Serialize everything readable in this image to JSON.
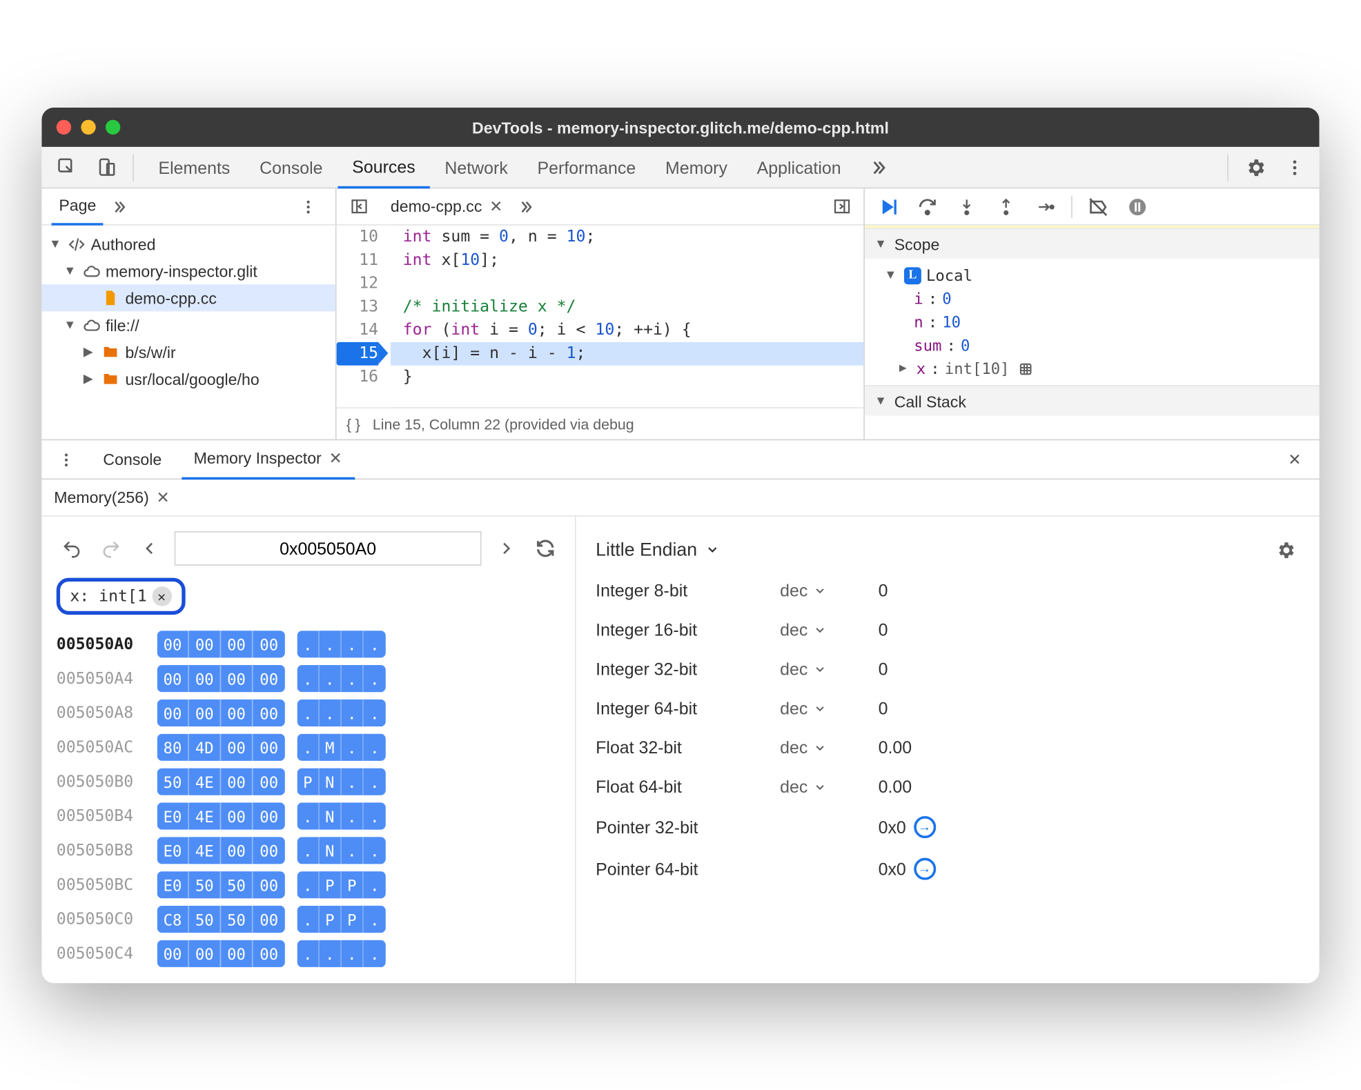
{
  "titlebar": {
    "title": "DevTools - memory-inspector.glitch.me/demo-cpp.html"
  },
  "tabs": {
    "items": [
      "Elements",
      "Console",
      "Sources",
      "Network",
      "Performance",
      "Memory",
      "Application"
    ],
    "active": "Sources"
  },
  "page_tree": {
    "header": "Page",
    "authored": "Authored",
    "site": "memory-inspector.glit",
    "file": "demo-cpp.cc",
    "file_scheme": "file://",
    "folder1": "b/s/w/ir",
    "folder2": "usr/local/google/ho"
  },
  "editor": {
    "tab": "demo-cpp.cc",
    "lines": {
      "10": "int sum = 0, n = 10;",
      "11": "int x[10];",
      "12": "",
      "13": "/* initialize x */",
      "14": "for (int i = 0; i < 10; ++i) {",
      "15": "  x[i] = n - i - 1;",
      "16": "}"
    },
    "status": "Line 15, Column 22 (provided via debug"
  },
  "scope": {
    "hdr": "Scope",
    "local": "Local",
    "vars": {
      "i_key": "i",
      "i_val": "0",
      "n_key": "n",
      "n_val": "10",
      "sum_key": "sum",
      "sum_val": "0",
      "x_key": "x",
      "x_type": "int[10]"
    },
    "callstack": "Call Stack"
  },
  "drawer": {
    "tabs": {
      "console": "Console",
      "mi": "Memory Inspector"
    },
    "mem_tab": "Memory(256)"
  },
  "mi": {
    "address": "0x005050A0",
    "chip": "x: int[1",
    "rows": [
      {
        "addr": "005050A0",
        "bytes": [
          "00",
          "00",
          "00",
          "00"
        ],
        "ascii": [
          ".",
          ".",
          ".",
          "."
        ]
      },
      {
        "addr": "005050A4",
        "bytes": [
          "00",
          "00",
          "00",
          "00"
        ],
        "ascii": [
          ".",
          ".",
          ".",
          "."
        ]
      },
      {
        "addr": "005050A8",
        "bytes": [
          "00",
          "00",
          "00",
          "00"
        ],
        "ascii": [
          ".",
          ".",
          ".",
          "."
        ]
      },
      {
        "addr": "005050AC",
        "bytes": [
          "80",
          "4D",
          "00",
          "00"
        ],
        "ascii": [
          ".",
          "M",
          ".",
          "."
        ]
      },
      {
        "addr": "005050B0",
        "bytes": [
          "50",
          "4E",
          "00",
          "00"
        ],
        "ascii": [
          "P",
          "N",
          ".",
          "."
        ]
      },
      {
        "addr": "005050B4",
        "bytes": [
          "E0",
          "4E",
          "00",
          "00"
        ],
        "ascii": [
          ".",
          "N",
          ".",
          "."
        ]
      },
      {
        "addr": "005050B8",
        "bytes": [
          "E0",
          "4E",
          "00",
          "00"
        ],
        "ascii": [
          ".",
          "N",
          ".",
          "."
        ]
      },
      {
        "addr": "005050BC",
        "bytes": [
          "E0",
          "50",
          "50",
          "00"
        ],
        "ascii": [
          ".",
          "P",
          "P",
          "."
        ]
      },
      {
        "addr": "005050C0",
        "bytes": [
          "C8",
          "50",
          "50",
          "00"
        ],
        "ascii": [
          ".",
          "P",
          "P",
          "."
        ]
      },
      {
        "addr": "005050C4",
        "bytes": [
          "00",
          "00",
          "00",
          "00"
        ],
        "ascii": [
          ".",
          ".",
          ".",
          "."
        ]
      }
    ],
    "endian": "Little Endian",
    "values": [
      {
        "label": "Integer 8-bit",
        "mode": "dec",
        "value": "0"
      },
      {
        "label": "Integer 16-bit",
        "mode": "dec",
        "value": "0"
      },
      {
        "label": "Integer 32-bit",
        "mode": "dec",
        "value": "0"
      },
      {
        "label": "Integer 64-bit",
        "mode": "dec",
        "value": "0"
      },
      {
        "label": "Float 32-bit",
        "mode": "dec",
        "value": "0.00"
      },
      {
        "label": "Float 64-bit",
        "mode": "dec",
        "value": "0.00"
      },
      {
        "label": "Pointer 32-bit",
        "mode": "",
        "value": "0x0",
        "jump": true
      },
      {
        "label": "Pointer 64-bit",
        "mode": "",
        "value": "0x0",
        "jump": true
      }
    ]
  }
}
